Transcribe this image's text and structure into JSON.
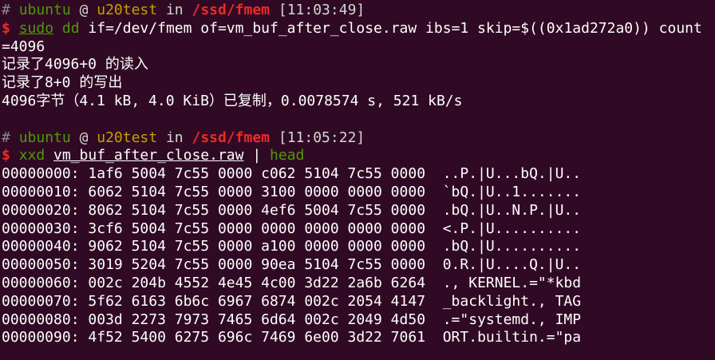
{
  "session1": {
    "prompt": {
      "hash": "#",
      "user": "ubuntu",
      "at": "@",
      "host": "u20test",
      "in": "in",
      "dir": "/ssd/fmem",
      "time": "[11:03:49]"
    },
    "command": {
      "dollar": "$",
      "sudo": "sudo",
      "cmd": "dd",
      "args": " if=/dev/fmem of=vm_buf_after_close.raw ibs=1 skip=$((0x1ad272a0)) count",
      "wrap": "=4096"
    },
    "output": [
      "记录了4096+0 的读入",
      "记录了8+0 的写出",
      "4096字节（4.1 kB, 4.0 KiB）已复制，0.0078574 s, 521 kB/s"
    ]
  },
  "session2": {
    "prompt": {
      "hash": "#",
      "user": "ubuntu",
      "at": "@",
      "host": "u20test",
      "in": "in",
      "dir": "/ssd/fmem",
      "time": "[11:05:22]"
    },
    "command": {
      "dollar": "$",
      "cmd": "xxd",
      "file": "vm_buf_after_close.raw",
      "pipe": "|",
      "pipe_cmd": "head"
    },
    "hexdump": [
      {
        "offset": "00000000:",
        "hex": "1af6 5004 7c55 0000 c062 5104 7c55 0000",
        "ascii": "..P.|U...bQ.|U.."
      },
      {
        "offset": "00000010:",
        "hex": "6062 5104 7c55 0000 3100 0000 0000 0000",
        "ascii": "`bQ.|U..1......."
      },
      {
        "offset": "00000020:",
        "hex": "8062 5104 7c55 0000 4ef6 5004 7c55 0000",
        "ascii": ".bQ.|U..N.P.|U.."
      },
      {
        "offset": "00000030:",
        "hex": "3cf6 5004 7c55 0000 0000 0000 0000 0000",
        "ascii": "<.P.|U.........."
      },
      {
        "offset": "00000040:",
        "hex": "9062 5104 7c55 0000 a100 0000 0000 0000",
        "ascii": ".bQ.|U.........."
      },
      {
        "offset": "00000050:",
        "hex": "3019 5204 7c55 0000 90ea 5104 7c55 0000",
        "ascii": "0.R.|U....Q.|U.."
      },
      {
        "offset": "00000060:",
        "hex": "002c 204b 4552 4e45 4c00 3d22 2a6b 6264",
        "ascii": "., KERNEL.=\"*kbd"
      },
      {
        "offset": "00000070:",
        "hex": "5f62 6163 6b6c 6967 6874 002c 2054 4147",
        "ascii": "_backlight., TAG"
      },
      {
        "offset": "00000080:",
        "hex": "003d 2273 7973 7465 6d64 002c 2049 4d50",
        "ascii": ".=\"systemd., IMP"
      },
      {
        "offset": "00000090:",
        "hex": "4f52 5400 6275 696c 7469 6e00 3d22 7061",
        "ascii": "ORT.builtin.=\"pa"
      }
    ]
  },
  "colors": {
    "background": "#300a24",
    "user": "#4e9a06",
    "host": "#c4a000",
    "dir": "#ef2929",
    "hash": "#888a85",
    "text": "#ffffff"
  }
}
